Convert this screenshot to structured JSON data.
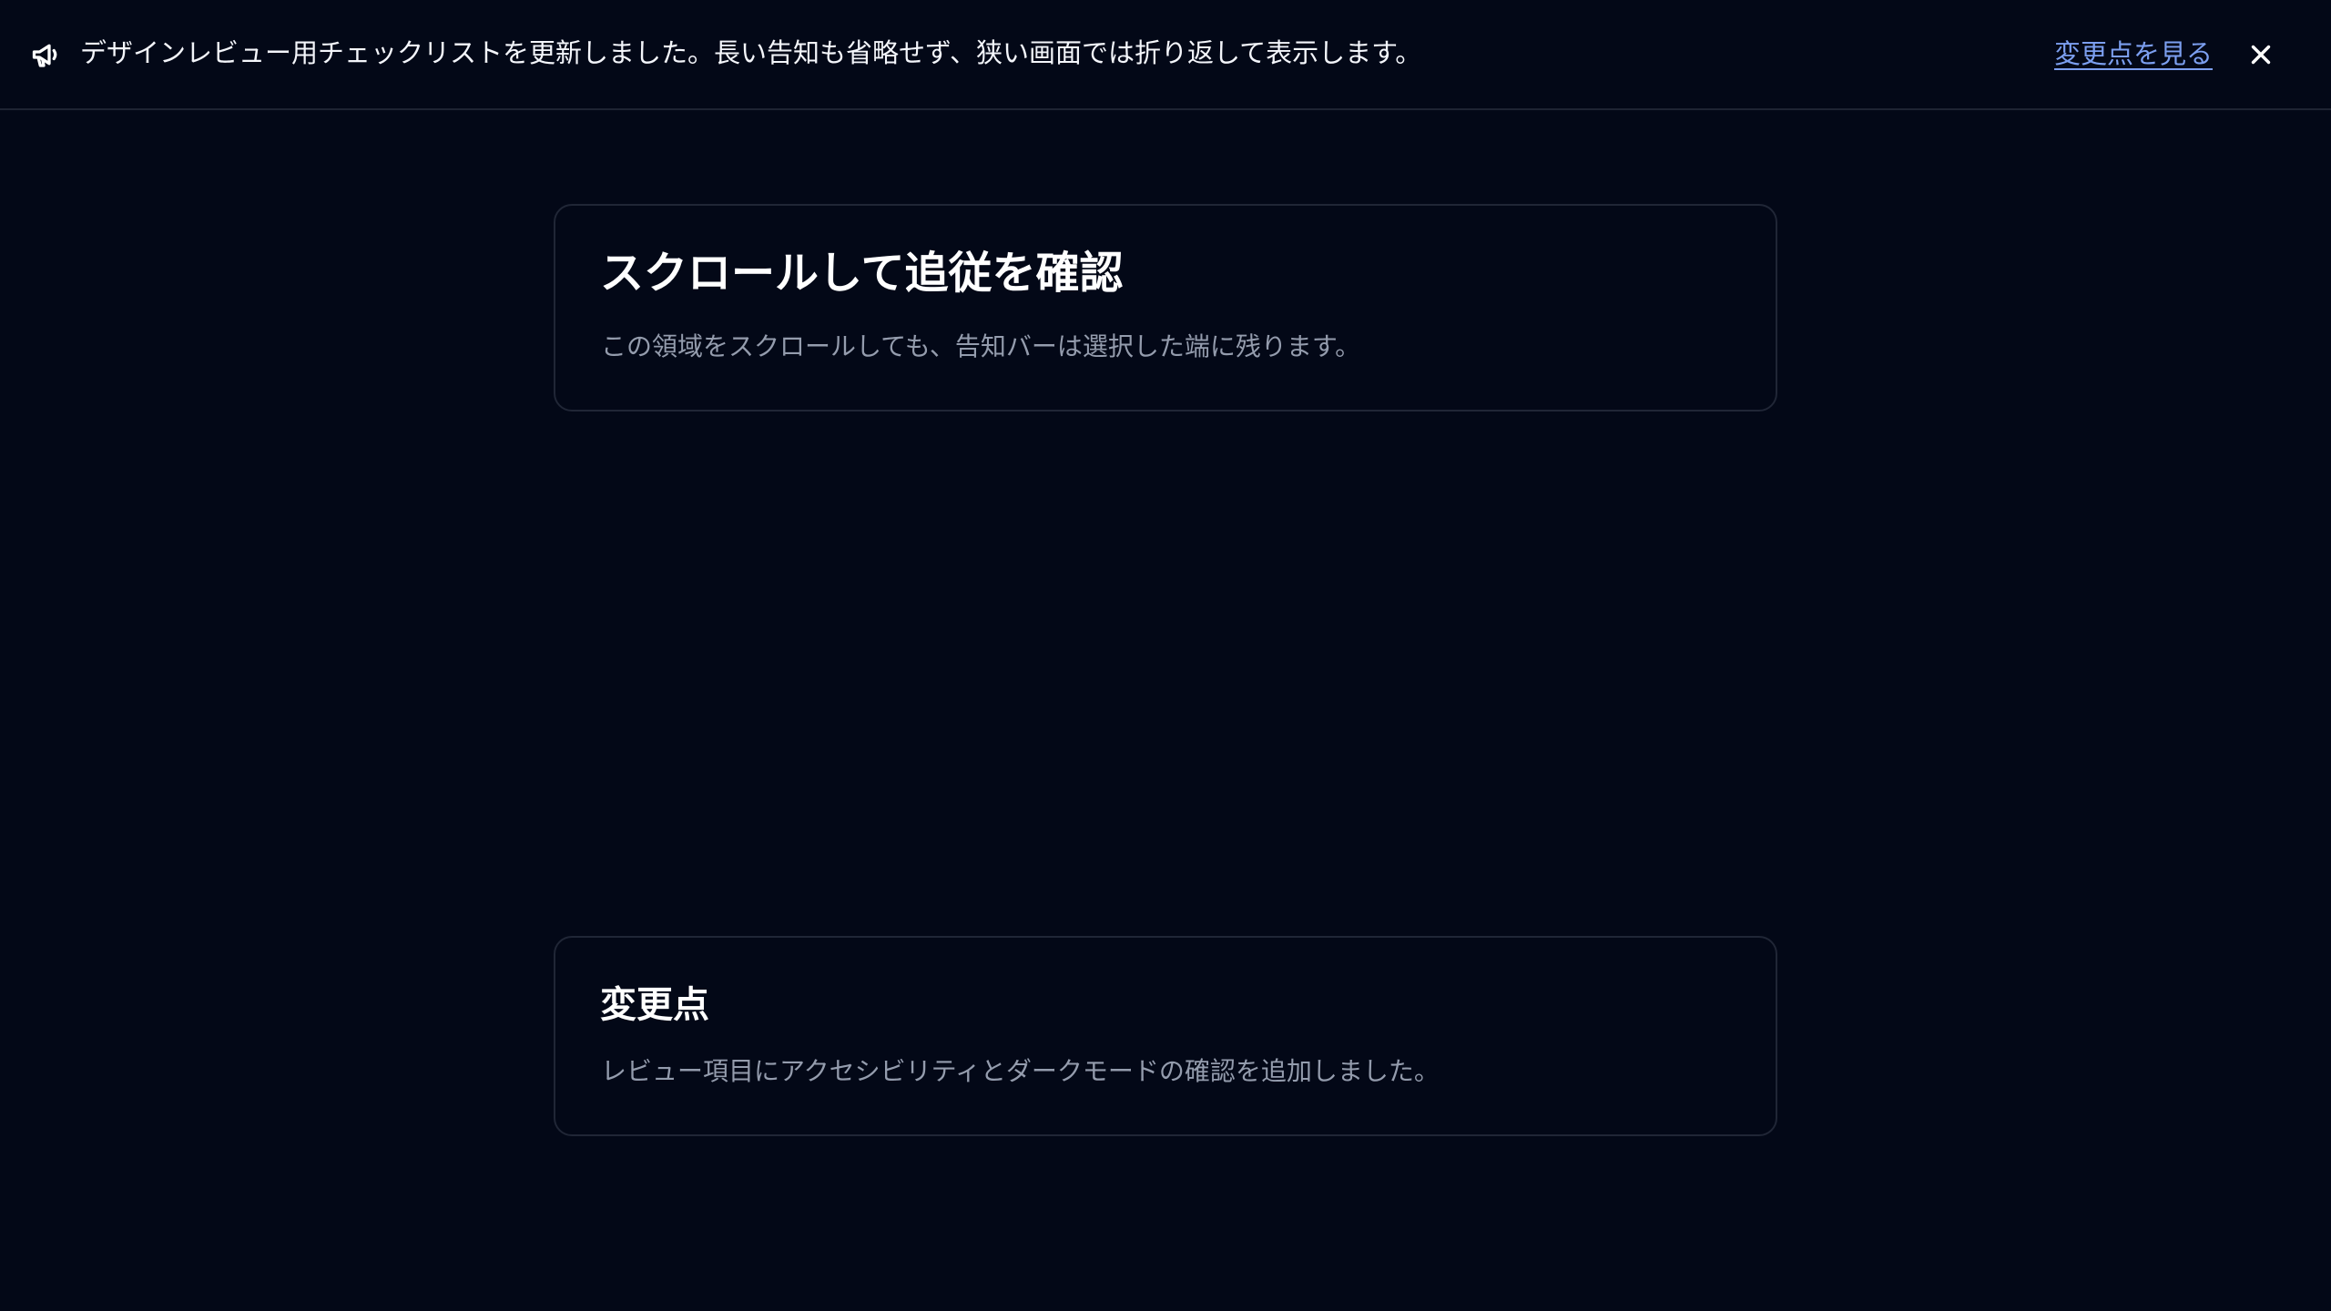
{
  "announcement": {
    "icon": "megaphone-icon",
    "message": "デザインレビュー用チェックリストを更新しました。長い告知も省略せず、狭い画面では折り返して表示します。",
    "link_label": "変更点を見る",
    "close_icon": "close-icon",
    "link_color": "#7c9ff0"
  },
  "cards": [
    {
      "title": "スクロールして追従を確認",
      "body": "この領域をスクロールしても、告知バーは選択した端に残ります。"
    },
    {
      "title": "変更点",
      "body": "レビュー項目にアクセシビリティとダークモードの確認を追加しました。"
    }
  ],
  "colors": {
    "background": "#030817",
    "border": "#202636",
    "text": "#ffffff",
    "muted_text": "#949cad"
  }
}
